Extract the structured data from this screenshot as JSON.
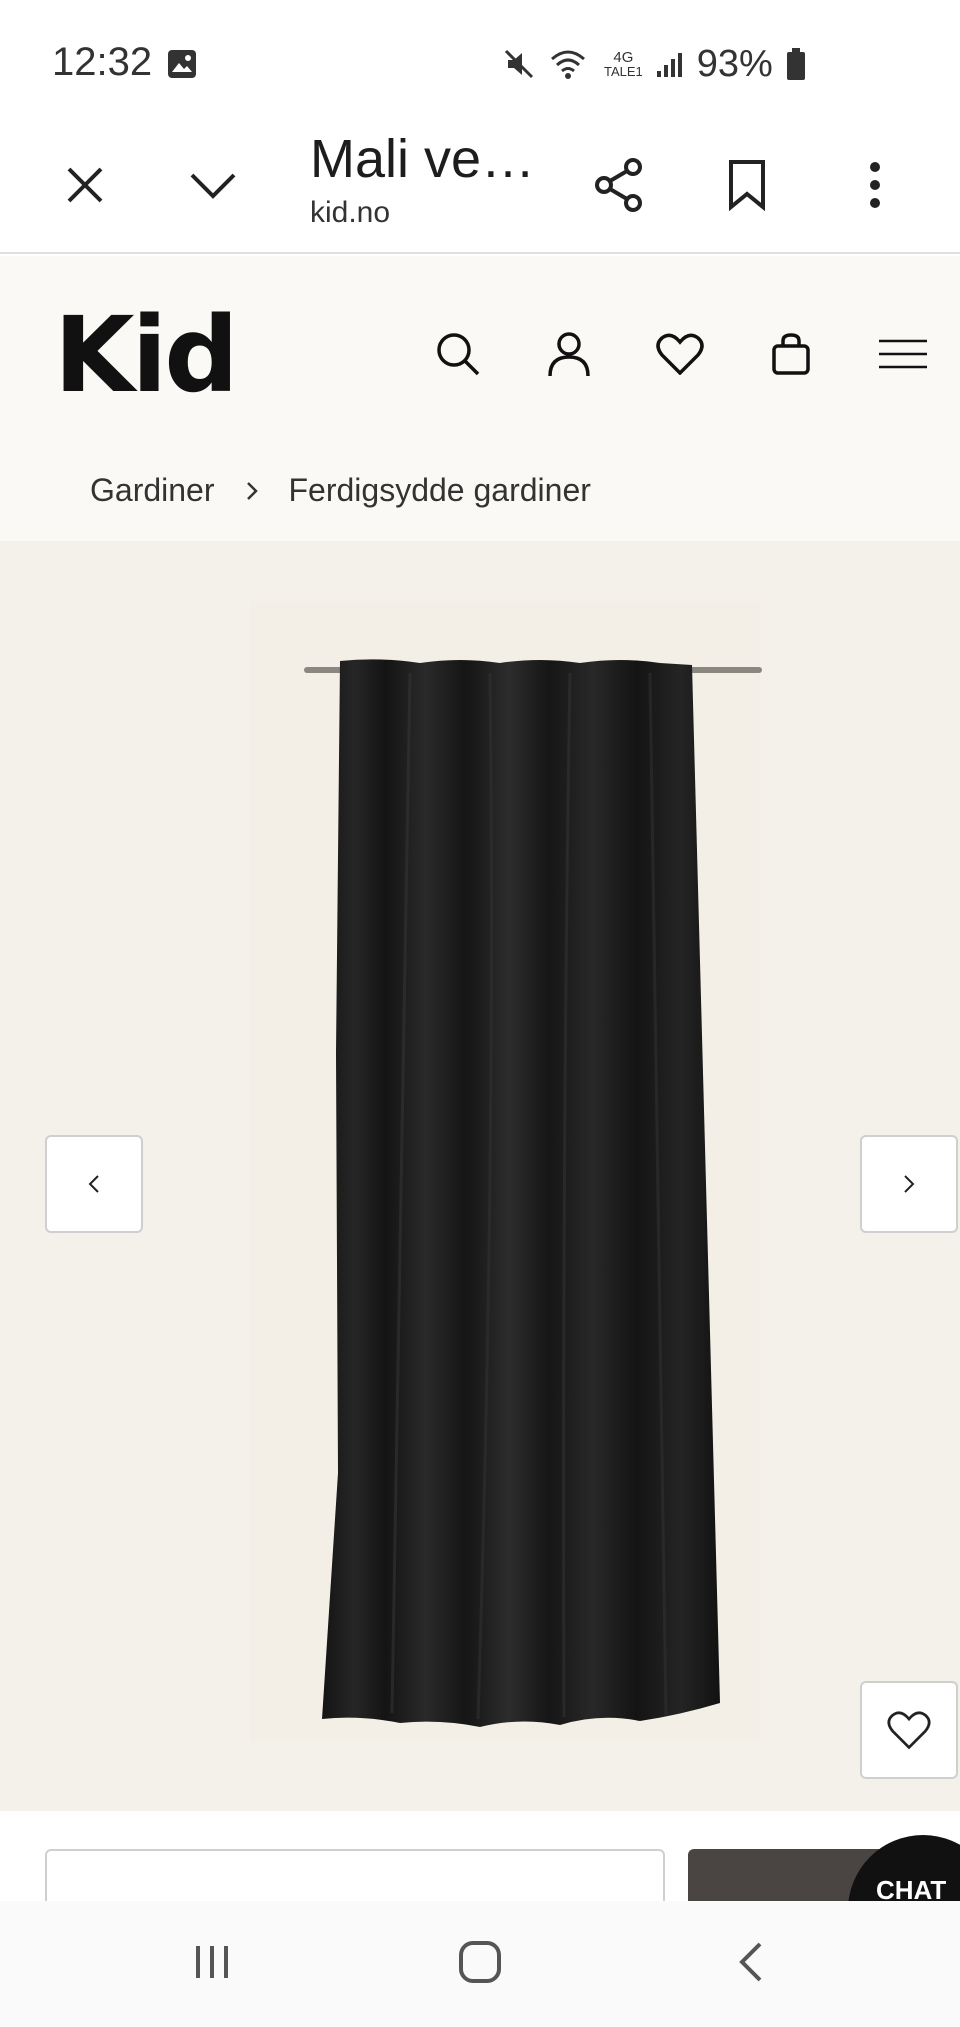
{
  "status_bar": {
    "time": "12:32",
    "network_top": "4G",
    "network_bottom": "TALE1",
    "battery": "93%"
  },
  "browser": {
    "page_title": "Mali ve…",
    "domain": "kid.no",
    "icons": [
      "close-icon",
      "chevron-down-icon",
      "share-icon",
      "bookmark-icon",
      "more-vert-icon"
    ]
  },
  "site": {
    "logo": "Kid",
    "header_icons": [
      "search-icon",
      "user-icon",
      "heart-icon",
      "bag-icon",
      "menu-icon"
    ]
  },
  "breadcrumb": {
    "items": [
      "Gardiner",
      "Ferdigsydde gardiner"
    ]
  },
  "gallery": {
    "product_image": "black velvet curtain",
    "controls": [
      "prev-arrow",
      "next-arrow",
      "wishlist-heart"
    ]
  },
  "chat": {
    "label": "CHAT"
  },
  "colors": {
    "page_bg": "#faf9f5",
    "gallery_bg": "#f4f1ea",
    "buy_button": "#4a4542",
    "curtain": "#1b1b1b"
  }
}
